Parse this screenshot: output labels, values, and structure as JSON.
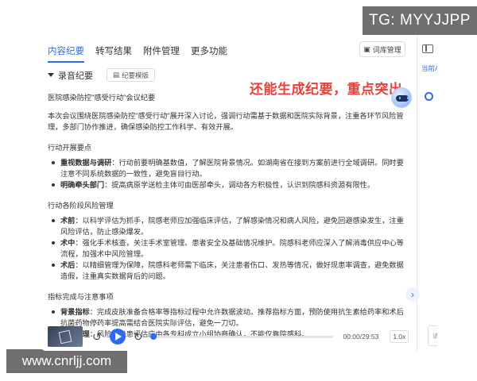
{
  "watermarks": {
    "top": "TG: MYYJJPP",
    "bottom": "www.cnrljj.com"
  },
  "tabs": [
    "内容纪要",
    "转写结果",
    "附件管理",
    "更多功能"
  ],
  "vocab_label": "词库管理",
  "side_text": "当前AI",
  "side_bottom": "请",
  "minutes": {
    "header": "录音纪要",
    "template_label": "纪要模版",
    "annotation": "还能生成纪要，重点突出",
    "title": "医院感染防控\"感受行动\"会议纪要",
    "intro": "本次会议围绕医院感染防控\"感受行动\"展开深入讨论，强调行动需基于数据和医院实际背景，注重各环节风险管理，多部门协作推进，确保感染防控工作科学、有效开展。",
    "sections": [
      {
        "title": "行动开展要点",
        "items": [
          {
            "label": "重视数据与调研",
            "text": "：行动前要明确基数值，了解医院背景情况。如湖南省在接到方案前进行全域调研。同时要注意不同系统数据的一致性，避免盲目行动。"
          },
          {
            "label": "明确牵头部门",
            "text": "：提高病原学送检主体可由医部牵头，调动各方积极性，认识到院感科资源有限性。"
          }
        ]
      },
      {
        "title": "行动各阶段风险管理",
        "items": [
          {
            "label": "术前",
            "text": "：以科学评估为抓手，院感老师应加强临床评估，了解感染情况和病人风险，避免回避感染发生，注重风险评估，防止感染爆发。"
          },
          {
            "label": "术中",
            "text": "：强化手术核查，关注手术室管理、患者安全及基础情况维护。院感科老师应深入了解消毒供应中心等流程，加强术中风险管理。"
          },
          {
            "label": "术后",
            "text": "：以精细管理为保障，院感科老师需下临床，关注患者伤口、发热等情况，做好现患率调查，避免数据造假，注重真实数据背后的问题。"
          }
        ]
      },
      {
        "title": "指标完成与注意事项",
        "items": [
          {
            "label": "背景指标",
            "text": "：完成皮肤准备合格率等指标过程中允许数据波动。推荐指标方面，预防使用抗生素给药率和术后抗菌药物停药率提高需结合医院实际评估，避免一刀切。"
          },
          {
            "label": "核查管理",
            "text": "：风险和隐患评估应由各专科成立小组协商确认，不能仅靠院感科。"
          }
        ]
      }
    ]
  },
  "player": {
    "time": "00:00/29:53",
    "speed": "1.0x",
    "progress": 0
  }
}
